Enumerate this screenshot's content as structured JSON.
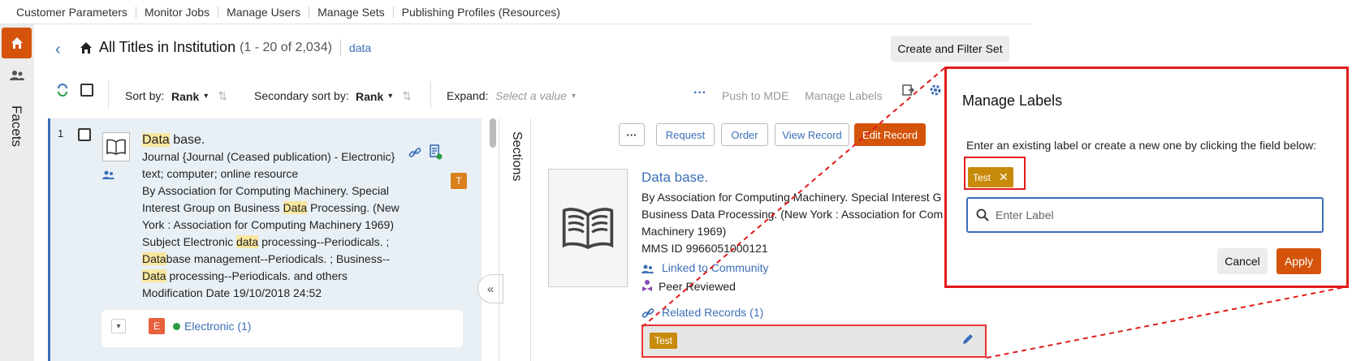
{
  "top_nav": [
    "Customer Parameters",
    "Monitor Jobs",
    "Manage Users",
    "Manage Sets",
    "Publishing Profiles (Resources)"
  ],
  "left_bar": {
    "facets_label": "Facets"
  },
  "header": {
    "title": "All Titles in Institution",
    "count": "(1 - 20 of 2,034)",
    "breadcrumb": "data",
    "create_filter_set": "Create and Filter Set"
  },
  "toolbar": {
    "sort_by_label": "Sort by:",
    "sort_by_value": "Rank",
    "secondary_sort_label": "Secondary sort by:",
    "secondary_sort_value": "Rank",
    "expand_label": "Expand:",
    "expand_placeholder": "Select a value",
    "push_to_mde": "Push to MDE",
    "manage_labels": "Manage Labels"
  },
  "result": {
    "index": "1",
    "title_highlight": "Data",
    "title_rest": " base.",
    "line_journal": "Journal {Journal (Ceased publication) - Electronic}",
    "line_type": "text; computer; online resource",
    "by_prefix": "By",
    "by_text_1": "Association for Computing Machinery. Special",
    "by_text_2a": "Interest Group on Business ",
    "by_text_2hl": "Data",
    "by_text_2b": " Processing. (New",
    "by_text_3": "York : Association for Computing Machinery 1969)",
    "subject_prefix": "Subject",
    "subj_1a": "Electronic ",
    "subj_1hl": "data",
    "subj_1b": " processing--Periodicals. ;",
    "subj_2hl": "Data",
    "subj_2b": "base management--Periodicals. ; Business--",
    "subj_3hl": "Data",
    "subj_3b": " processing--Periodicals. and others",
    "mod_prefix": "Modification Date",
    "mod_value": "19/10/2018 24:52",
    "badge": "T",
    "electronic_badge": "E",
    "electronic_link": "Electronic (1)"
  },
  "sections_label": "Sections",
  "record": {
    "buttons": [
      "Request",
      "Order",
      "View Record",
      "Edit Record"
    ],
    "title": "Data base.",
    "by_prefix": "By",
    "by_text_1": "Association for Computing Machinery. Special Interest G",
    "by_text_2": "Business Data Processing. (New York : Association for Com",
    "by_text_3": "Machinery 1969)",
    "mms_prefix": "MMS ID",
    "mms_value": "9966051000121",
    "linked": "Linked to Community",
    "peer": "Peer Reviewed",
    "related": "Related Records (1)",
    "label_tag": "Test"
  },
  "modal": {
    "title": "Manage Labels",
    "description": "Enter an existing label or create a new one by clicking the field below:",
    "tag": "Test",
    "input_placeholder": "Enter Label",
    "cancel": "Cancel",
    "apply": "Apply"
  },
  "colors": {
    "accent": "#d4540b",
    "link": "#3b6fb6",
    "highlight_box": "#e21b1b",
    "tag": "#c78a0b"
  }
}
